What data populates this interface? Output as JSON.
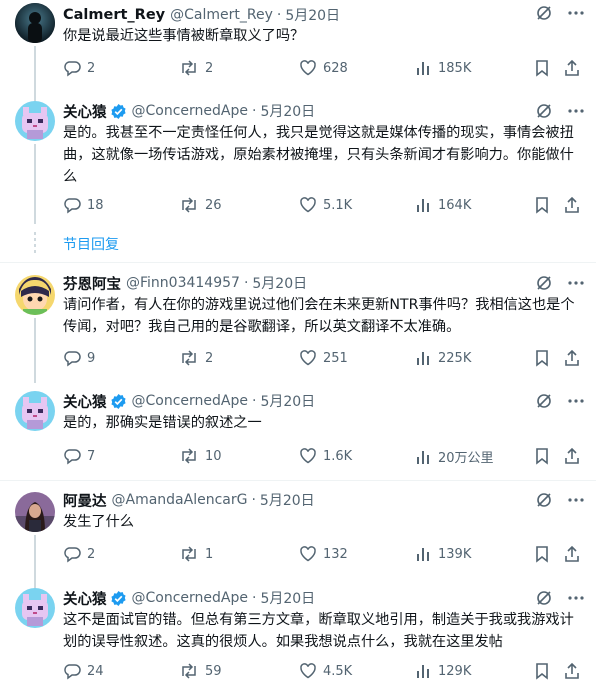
{
  "section_link": "节目回复",
  "colors": {
    "text": "#0f1419",
    "muted": "#536471",
    "accent": "#1d9bf0",
    "line": "#cfd9de"
  },
  "tweets": [
    {
      "name": "Calmert_Rey",
      "handle": "@Calmert_Rey",
      "dot": "·",
      "date": "5月20日",
      "verified": false,
      "text": "你是说最近这些事情被断章取义了吗？",
      "avatar": "silhouette-avatar",
      "stats": {
        "replies": "2",
        "retweets": "2",
        "likes": "628",
        "views": "185K"
      }
    },
    {
      "name": "关心猿",
      "handle": "@ConcernedApe",
      "dot": "·",
      "date": "5月20日",
      "verified": true,
      "text": "是的。我甚至不一定责怪任何人，我只是觉得这就是媒体传播的现实，事情会被扭曲，这就像一场传话游戏，原始素材被掩埋，只有头条新闻才有影响力。你能做什么",
      "avatar": "pixel-cat-avatar",
      "stats": {
        "replies": "18",
        "retweets": "26",
        "likes": "5.1K",
        "views": "164K"
      }
    },
    {
      "name": "芬恩阿宝",
      "handle": "@Finn03414957",
      "dot": "·",
      "date": "5月20日",
      "verified": false,
      "text": "请问作者，有人在你的游戏里说过他们会在未来更新NTR事件吗？我相信这也是个传闻，对吧？我自己用的是谷歌翻译，所以英文翻译不太准确。",
      "avatar": "cartoon-avatar",
      "stats": {
        "replies": "9",
        "retweets": "2",
        "likes": "251",
        "views": "225K"
      }
    },
    {
      "name": "关心猿",
      "handle": "@ConcernedApe",
      "dot": "·",
      "date": "5月20日",
      "verified": true,
      "text": "是的，那确实是错误的叙述之一",
      "avatar": "pixel-cat-avatar",
      "stats": {
        "replies": "7",
        "retweets": "10",
        "likes": "1.6K",
        "views": "20万公里"
      }
    },
    {
      "name": "阿曼达",
      "handle": "@AmandaAlencarG",
      "dot": "·",
      "date": "5月20日",
      "verified": false,
      "text": "发生了什么",
      "avatar": "photo-avatar",
      "stats": {
        "replies": "2",
        "retweets": "1",
        "likes": "132",
        "views": "139K"
      }
    },
    {
      "name": "关心猿",
      "handle": "@ConcernedApe",
      "dot": "·",
      "date": "5月20日",
      "verified": true,
      "text": "这不是面试官的错。但总有第三方文章，断章取义地引用，制造关于我或我游戏计划的误导性叙述。这真的很烦人。如果我想说点什么，我就在这里发帖",
      "avatar": "pixel-cat-avatar",
      "stats": {
        "replies": "24",
        "retweets": "59",
        "likes": "4.5K",
        "views": "129K"
      }
    }
  ]
}
